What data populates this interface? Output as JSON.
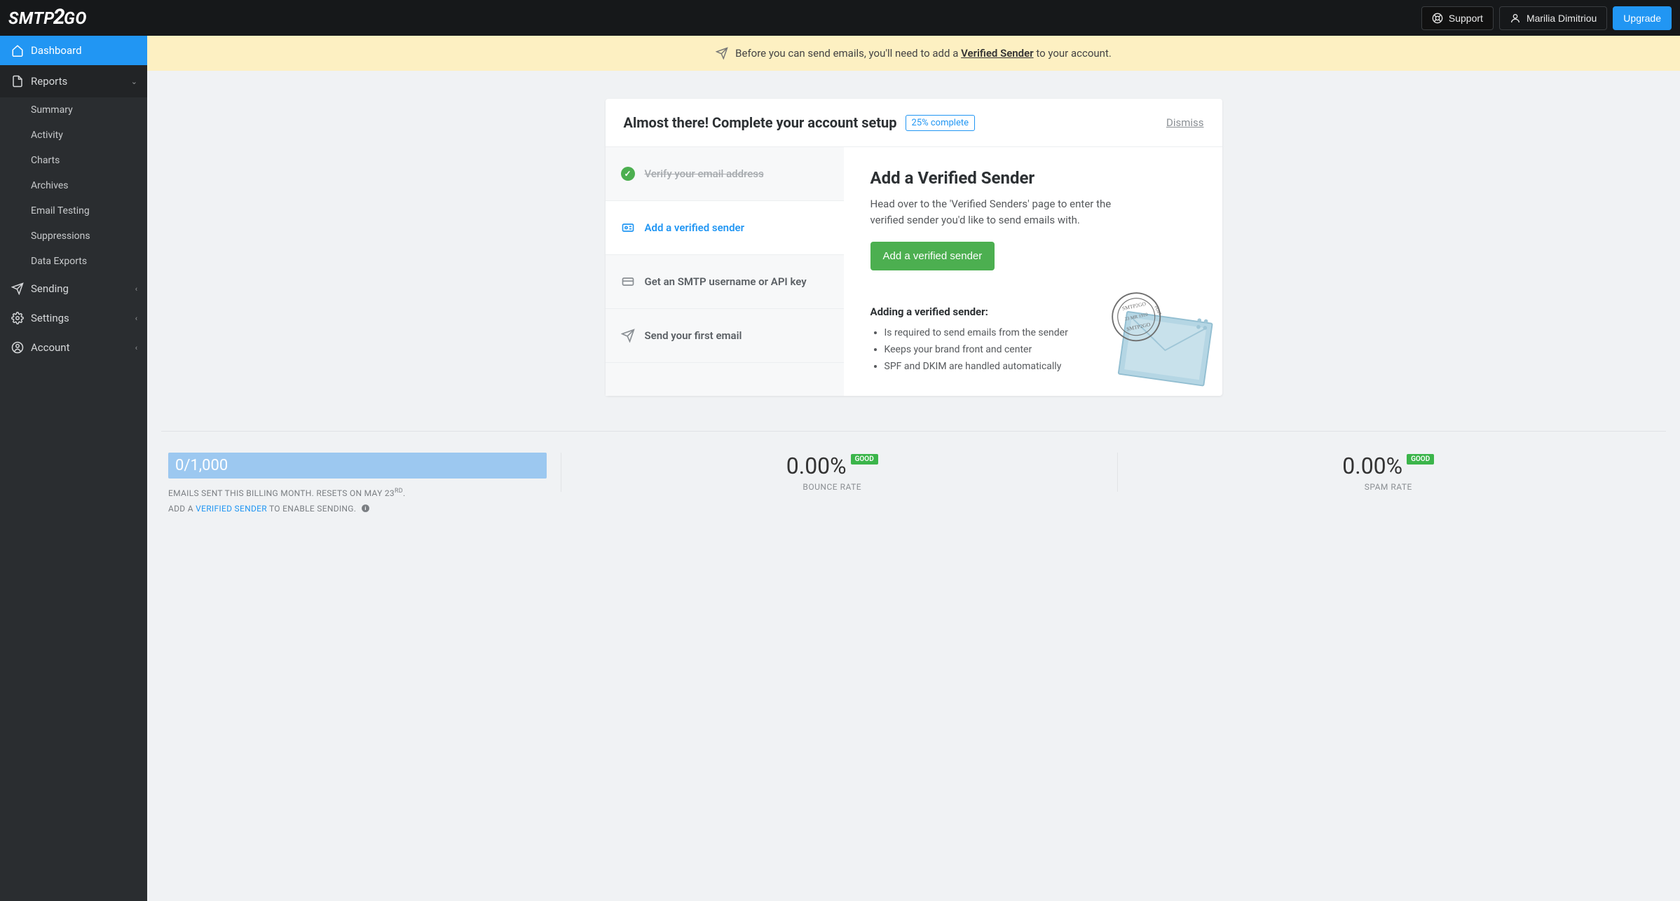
{
  "topbar": {
    "support": "Support",
    "user": "Marilia Dimitriou",
    "upgrade": "Upgrade"
  },
  "sidebar": {
    "dashboard": "Dashboard",
    "reports": "Reports",
    "reports_items": [
      "Summary",
      "Activity",
      "Charts",
      "Archives",
      "Email Testing",
      "Suppressions",
      "Data Exports"
    ],
    "sending": "Sending",
    "settings": "Settings",
    "account": "Account"
  },
  "banner": {
    "prefix": "Before you can send emails, you'll need to add a ",
    "link": "Verified Sender",
    "suffix": " to your account."
  },
  "setup": {
    "title": "Almost there! Complete your account setup",
    "badge": "25% complete",
    "dismiss": "Dismiss",
    "steps": {
      "verify": "Verify your email address",
      "add_sender": "Add a verified sender",
      "api_key": "Get an SMTP username or API key",
      "send": "Send your first email"
    },
    "detail": {
      "title": "Add a Verified Sender",
      "desc": "Head over to the 'Verified Senders' page to enter the verified sender you'd like to send emails with.",
      "button": "Add a verified sender",
      "sub_title": "Adding a verified sender:",
      "bullets": [
        "Is required to send emails from the sender",
        "Keeps your brand front and center",
        "SPF and DKIM are handled automatically"
      ]
    }
  },
  "usage": {
    "count": "0/1,000",
    "line1_a": "EMAILS SENT THIS BILLING MONTH. RESETS ON MAY 23",
    "line1_sup": "RD",
    "line1_b": ".",
    "line2_a": "ADD A ",
    "line2_link": "VERIFIED SENDER",
    "line2_b": " TO ENABLE SENDING."
  },
  "metrics": {
    "bounce_val": "0.00%",
    "bounce_badge": "GOOD",
    "bounce_label": "BOUNCE RATE",
    "spam_val": "0.00%",
    "spam_badge": "GOOD",
    "spam_label": "SPAM RATE"
  }
}
